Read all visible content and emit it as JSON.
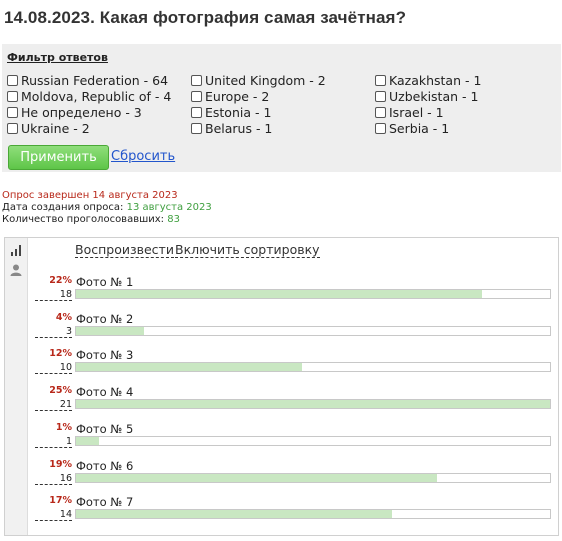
{
  "page": {
    "title": "14.08.2023. Какая фотография самая зачётная?"
  },
  "filter": {
    "title": "Фильтр ответов",
    "countries": [
      "Russian Federation - 64",
      "United Kingdom - 2",
      "Kazakhstan - 1",
      "Moldova, Republic of - 4",
      "Europe - 2",
      "Uzbekistan - 1",
      "Не определено - 3",
      "Estonia - 1",
      "Israel - 1",
      "Ukraine - 2",
      "Belarus - 1",
      "Serbia - 1"
    ],
    "apply_label": "Применить",
    "reset_label": "Сбросить"
  },
  "status": {
    "completed_text": "Опрос завершен 14 августа 2023",
    "created_label": "Дата создания опроса: ",
    "created_value": "13 августа 2023",
    "voters_label": "Количество проголосовавших: ",
    "voters_value": "83"
  },
  "results": {
    "play_label": "Воспроизвести",
    "sort_label": "Включить сортировку",
    "icons": [
      "bar-chart-icon",
      "user-icon"
    ],
    "options": [
      {
        "label": "Фото № 1",
        "percent": "22%",
        "count": "18",
        "votes": 18
      },
      {
        "label": "Фото № 2",
        "percent": "4%",
        "count": "3",
        "votes": 3
      },
      {
        "label": "Фото № 3",
        "percent": "12%",
        "count": "10",
        "votes": 10
      },
      {
        "label": "Фото № 4",
        "percent": "25%",
        "count": "21",
        "votes": 21
      },
      {
        "label": "Фото № 5",
        "percent": "1%",
        "count": "1",
        "votes": 1
      },
      {
        "label": "Фото № 6",
        "percent": "19%",
        "count": "16",
        "votes": 16
      },
      {
        "label": "Фото № 7",
        "percent": "17%",
        "count": "14",
        "votes": 14
      }
    ],
    "max_votes": 21
  },
  "colors": {
    "accent_red": "#b8281a",
    "accent_green": "#3f9f3f",
    "bar_fill": "#c9e7c2",
    "button_green": "#5ec548",
    "link_blue": "#2255cc"
  }
}
